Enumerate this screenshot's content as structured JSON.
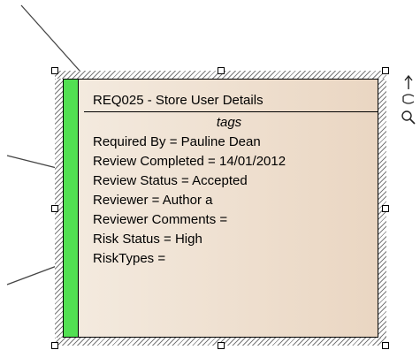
{
  "element": {
    "title": "REQ025 - Store User Details",
    "tags_heading": "tags",
    "tags": [
      "Required By = Pauline Dean",
      "Review Completed = 14/01/2012",
      "Review Status = Accepted",
      "Reviewer = Author a",
      "Reviewer Comments =",
      "Risk Status = High",
      "RiskTypes ="
    ],
    "status_color": "#52e052",
    "fill_color": "#ead6c2"
  },
  "toolbar": {
    "icons": [
      "arrow-up-icon",
      "link-handle-icon",
      "search-icon"
    ]
  }
}
